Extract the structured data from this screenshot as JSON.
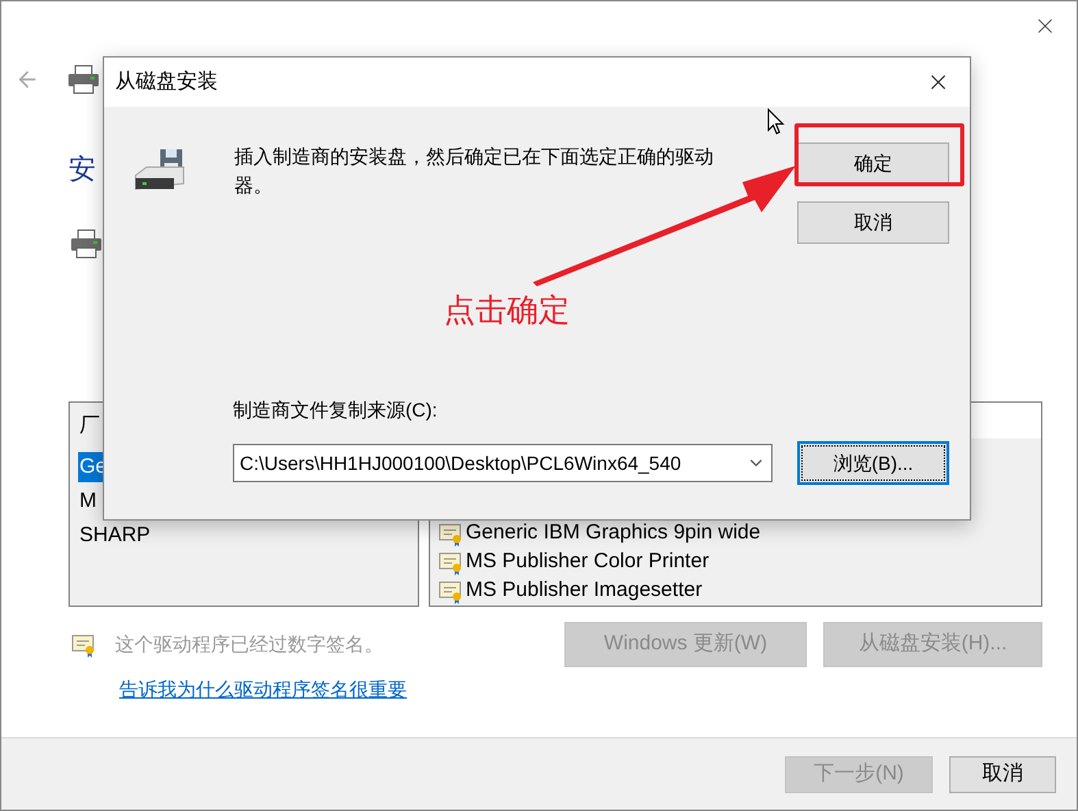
{
  "page": {
    "heading": "安"
  },
  "manufacturers": {
    "header": "厂",
    "items": [
      {
        "label": "Ge",
        "selected": true
      },
      {
        "label": "M",
        "selected": false
      },
      {
        "label": "SHARP",
        "selected": false
      }
    ]
  },
  "printers": {
    "items": [
      {
        "label": "Generic IBM Graphics 9pin wide"
      },
      {
        "label": "MS Publisher Color Printer"
      },
      {
        "label": "MS Publisher Imagesetter"
      }
    ]
  },
  "signature": {
    "text": "这个驱动程序已经过数字签名。"
  },
  "side_buttons": [
    {
      "label": "Windows 更新(W)",
      "disabled": true
    },
    {
      "label": "从磁盘安装(H)...",
      "disabled": true
    }
  ],
  "link": "告诉我为什么驱动程序签名很重要",
  "footer_buttons": [
    {
      "label": "下一步(N)",
      "disabled": true
    },
    {
      "label": "取消",
      "disabled": false
    }
  ],
  "dialog": {
    "title": "从磁盘安装",
    "message": "插入制造商的安装盘，然后确定已在下面选定正确的驱动器。",
    "buttons": [
      {
        "label": "确定",
        "highlighted": true
      },
      {
        "label": "取消",
        "highlighted": false
      }
    ],
    "source_label": "制造商文件复制来源(C):",
    "source_value": "C:\\Users\\HH1HJ000100\\Desktop\\PCL6Winx64_540",
    "browse": {
      "label": "浏览(B)...",
      "focused": true
    }
  },
  "annotation": {
    "text": "点击确定"
  }
}
